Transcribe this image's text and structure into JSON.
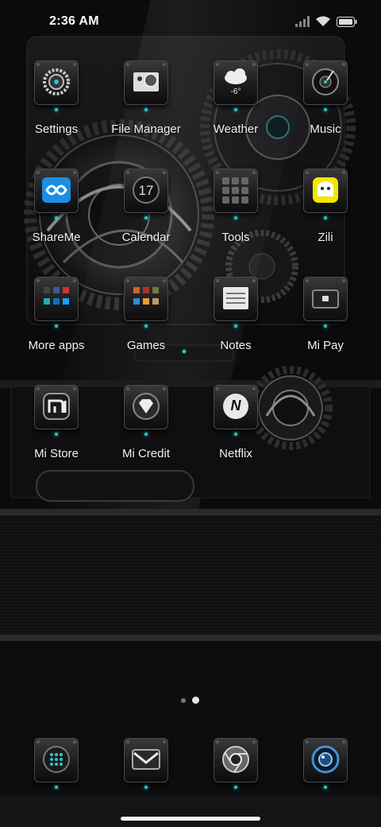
{
  "status_bar": {
    "time": "2:36 AM",
    "icons": [
      "signal-icon",
      "wifi-icon",
      "battery-icon"
    ]
  },
  "apps": [
    {
      "label": "Settings",
      "icon": "settings-icon"
    },
    {
      "label": "File Manager",
      "icon": "file-manager-icon"
    },
    {
      "label": "Weather",
      "icon": "weather-icon",
      "badge": "-6°"
    },
    {
      "label": "Music",
      "icon": "music-icon"
    },
    {
      "label": "ShareMe",
      "icon": "shareme-icon"
    },
    {
      "label": "Calendar",
      "icon": "calendar-icon",
      "badge": "17"
    },
    {
      "label": "Tools",
      "icon": "tools-folder-icon"
    },
    {
      "label": "Zili",
      "icon": "zili-icon"
    },
    {
      "label": "More apps",
      "icon": "more-apps-folder-icon"
    },
    {
      "label": "Games",
      "icon": "games-folder-icon"
    },
    {
      "label": "Notes",
      "icon": "notes-icon"
    },
    {
      "label": "Mi Pay",
      "icon": "mi-pay-icon"
    },
    {
      "label": "Mi Store",
      "icon": "mi-store-icon"
    },
    {
      "label": "Mi Credit",
      "icon": "mi-credit-icon"
    },
    {
      "label": "Netflix",
      "icon": "netflix-icon",
      "badge": "N"
    }
  ],
  "dock": [
    {
      "icon": "phone-dialer-icon"
    },
    {
      "icon": "messages-icon"
    },
    {
      "icon": "chrome-icon"
    },
    {
      "icon": "camera-icon"
    }
  ],
  "pager": {
    "pages": 2,
    "current": 2
  },
  "colors": {
    "accent": "#2ec6c6",
    "background": "#0b0b0c",
    "label": "#f2f2f2"
  }
}
